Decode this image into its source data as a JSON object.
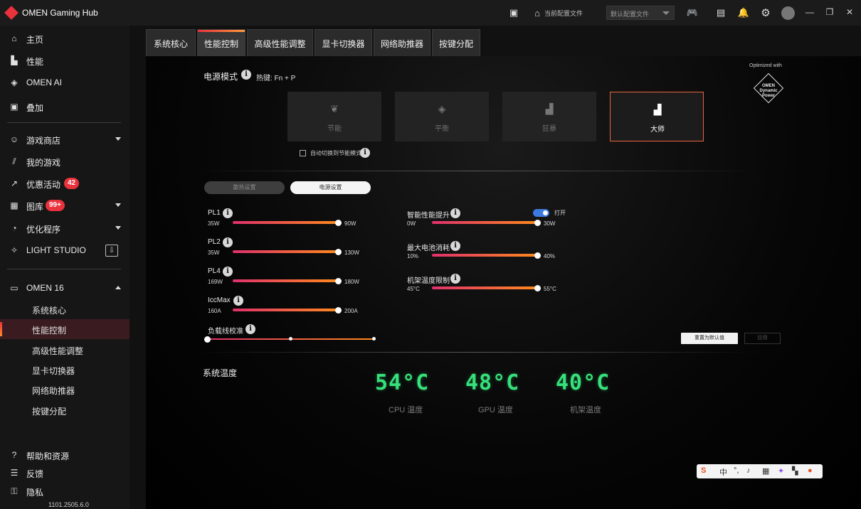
{
  "app": {
    "title": "OMEN Gaming Hub"
  },
  "titlebar": {
    "profile_label": "当前配置文件",
    "profile_value": "默认配置文件"
  },
  "sidebar": {
    "items": [
      {
        "label": "主页",
        "icon": "home-icon"
      },
      {
        "label": "性能",
        "icon": "bar-chart-icon"
      },
      {
        "label": "OMEN AI",
        "icon": "diamond-icon"
      },
      {
        "label": "叠加",
        "icon": "overlay-icon"
      },
      {
        "label": "游戏商店",
        "icon": "gamepad-icon"
      },
      {
        "label": "我的游戏",
        "icon": "library-icon"
      },
      {
        "label": "优惠活动",
        "icon": "trend-icon",
        "badge": "42"
      },
      {
        "label": "图库",
        "icon": "gallery-icon",
        "badge": "99+"
      },
      {
        "label": "优化程序",
        "icon": "optimizer-icon"
      },
      {
        "label": "LIGHT STUDIO",
        "icon": "sparkle-icon"
      }
    ],
    "device": "OMEN 16",
    "sub_items": [
      "系统核心",
      "性能控制",
      "高级性能调整",
      "显卡切换器",
      "网络助推器",
      "按键分配"
    ],
    "bottom": [
      {
        "label": "帮助和资源",
        "icon": "help-icon"
      },
      {
        "label": "反馈",
        "icon": "feedback-icon"
      },
      {
        "label": "隐私",
        "icon": "privacy-icon"
      }
    ],
    "version": "1101.2505.6.0"
  },
  "tabs": [
    "系统核心",
    "性能控制",
    "高级性能调整",
    "显卡切换器",
    "网络助推器",
    "按键分配"
  ],
  "power_mode": {
    "title": "电源模式",
    "hotkey": "热键: Fn + P",
    "modes": [
      "节能",
      "平衡",
      "狂暴",
      "大师"
    ],
    "active_mode": "大师",
    "auto_switch_label": "自动切换到节能模式",
    "optimized_with": "Optimized with",
    "badge_text": "OMEN Dynamic Power"
  },
  "settings_tabs": {
    "cooling": "散热设置",
    "power": "电源设置"
  },
  "sliders_left": [
    {
      "name": "PL1",
      "min": "35W",
      "max": "90W",
      "fraction": 1.0
    },
    {
      "name": "PL2",
      "min": "35W",
      "max": "130W",
      "fraction": 1.0
    },
    {
      "name": "PL4",
      "min": "169W",
      "max": "180W",
      "fraction": 1.0
    },
    {
      "name": "IccMax",
      "min": "160A",
      "max": "200A",
      "fraction": 1.0
    }
  ],
  "load_line": {
    "name": "负载线校准"
  },
  "sliders_right": [
    {
      "name": "智能性能提升",
      "min": "0W",
      "max": "30W",
      "fraction": 1.0,
      "toggle_label": "打开"
    },
    {
      "name": "最大电池消耗",
      "min": "10%",
      "max": "40%",
      "fraction": 1.0
    },
    {
      "name": "机架温度限制",
      "min": "45°C",
      "max": "55°C",
      "fraction": 1.0
    }
  ],
  "buttons": {
    "reset": "重置为默认值",
    "apply": "应用"
  },
  "system_temp": {
    "title": "系统温度",
    "readings": [
      {
        "value": "54°C",
        "label": "CPU 温度"
      },
      {
        "value": "48°C",
        "label": "GPU 温度"
      },
      {
        "value": "40°C",
        "label": "机架温度"
      }
    ]
  },
  "ime": {
    "zh": "中"
  },
  "colors": {
    "accent": "#e8323c",
    "temp_green": "#36e07a",
    "toggle_blue": "#3c7ae0"
  }
}
